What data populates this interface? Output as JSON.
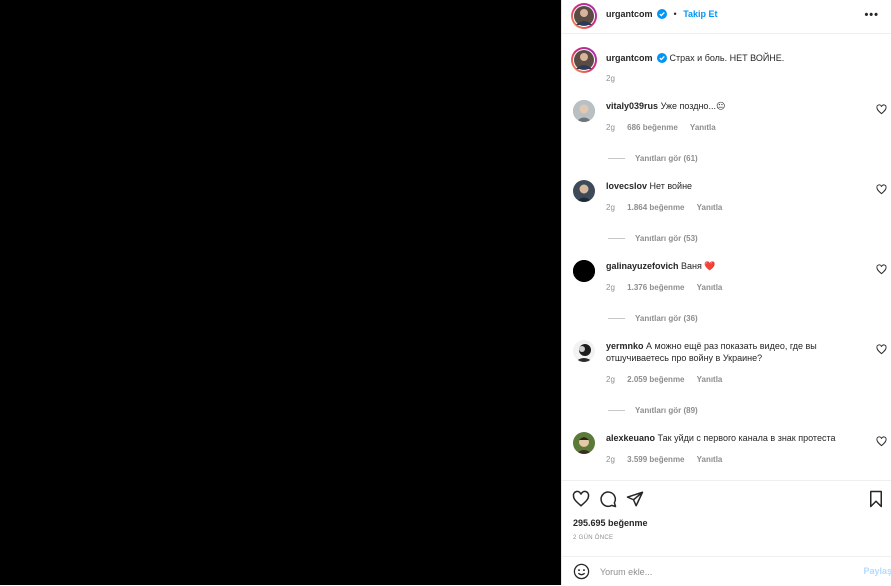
{
  "post": {
    "username": "urgantcom",
    "follow_label": "Takip Et",
    "dot": "•",
    "more_label": "•••",
    "caption": "Страх и боль. НЕТ ВОЙНЕ.",
    "caption_time": "2g"
  },
  "comments": [
    {
      "username": "vitaly039rus",
      "text": "Уже поздно...😐",
      "time": "2g",
      "likes": "686 beğenme",
      "reply_label": "Yanıtla",
      "view_replies": "Yanıtları gör (61)"
    },
    {
      "username": "lovecslov",
      "text": "Нет войне",
      "time": "2g",
      "likes": "1.864 beğenme",
      "reply_label": "Yanıtla",
      "view_replies": "Yanıtları gör (53)"
    },
    {
      "username": "galinayuzefovich",
      "text": "Ваня ❤️",
      "time": "2g",
      "likes": "1.376 beğenme",
      "reply_label": "Yanıtla",
      "view_replies": "Yanıtları gör (36)"
    },
    {
      "username": "yermnko",
      "text": "А можно ещё раз показать видео, где вы отшучиваетесь про войну в Украине?",
      "time": "2g",
      "likes": "2.059 beğenme",
      "reply_label": "Yanıtla",
      "view_replies": "Yanıtları gör (89)"
    },
    {
      "username": "alexkeuano",
      "text": "Так уйди с первого канала в знак протеста",
      "time": "2g",
      "likes": "3.599 beğenme",
      "reply_label": "Yanıtla"
    }
  ],
  "footer": {
    "likes": "295.695 beğenme",
    "posted": "2 GÜN ÖNCE",
    "comment_placeholder": "Yorum ekle...",
    "post_label": "Paylaş"
  },
  "colors": {
    "accent": "#0095f6",
    "heart": "#ed4956",
    "muted": "#8e8e8e"
  },
  "icons": [
    "verified-badge-icon",
    "heart-icon",
    "comment-icon",
    "share-icon",
    "bookmark-icon",
    "emoji-icon",
    "more-icon"
  ]
}
